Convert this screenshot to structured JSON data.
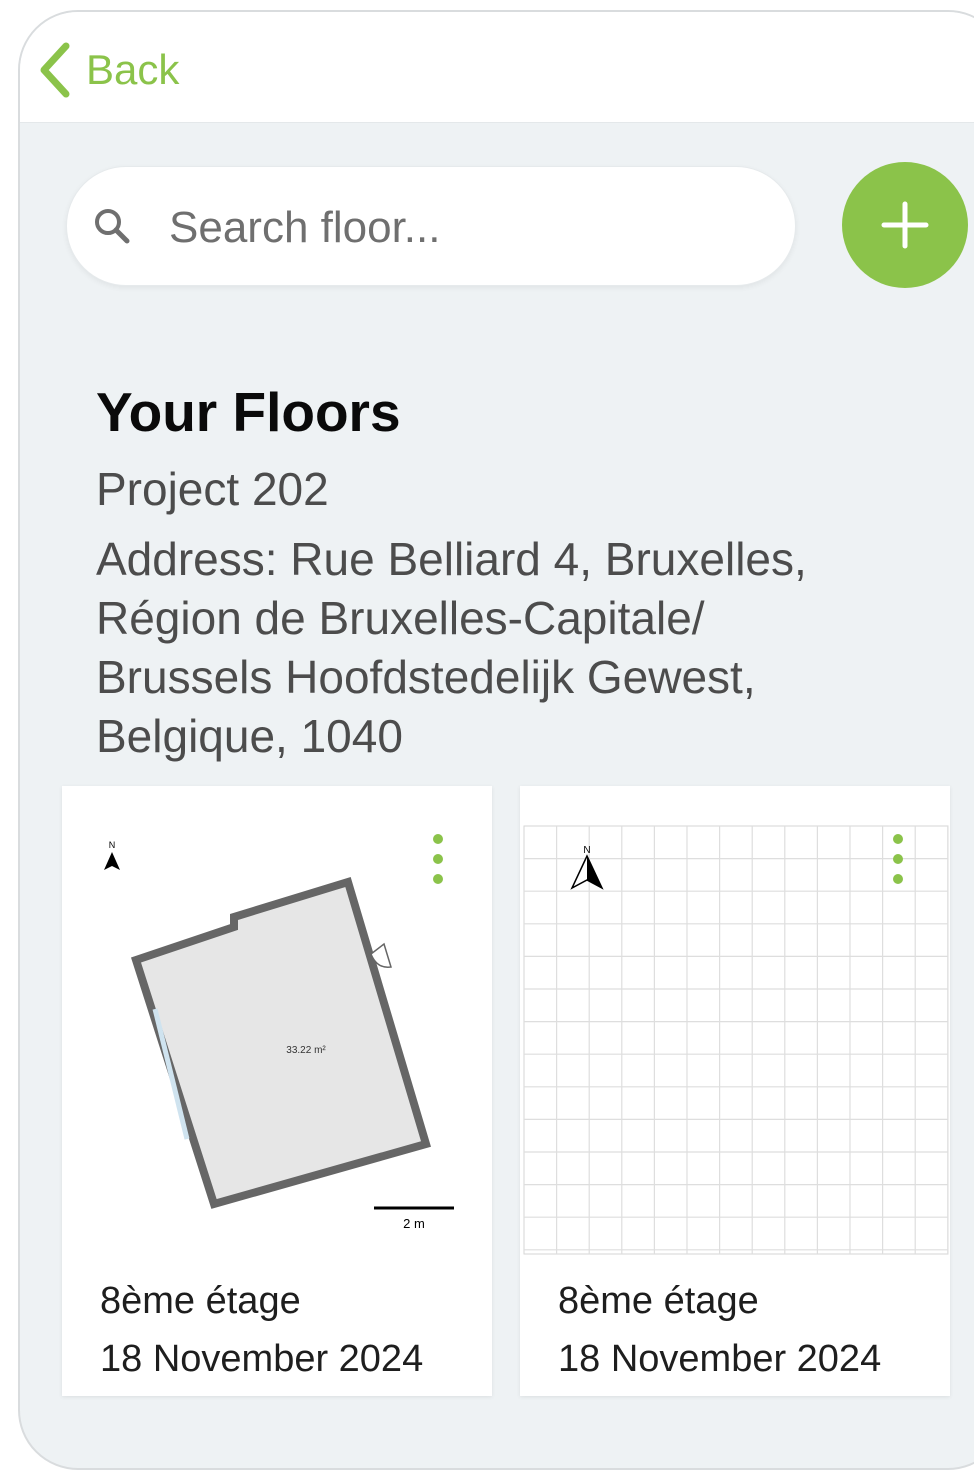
{
  "nav": {
    "back_label": "Back"
  },
  "search": {
    "placeholder": "Search floor...",
    "value": ""
  },
  "add_button": {
    "icon": "plus-icon"
  },
  "section": {
    "title": "Your Floors",
    "project_name": "Project 202",
    "address": "Address: Rue Belliard 4, Bruxelles, Région de Bruxelles-Capitale/ Brussels Hoofdstedelijk Gewest, Belgique, 1040"
  },
  "floors": [
    {
      "name": "8ème étage",
      "date": "18 November 2024",
      "plan_area": "33.22 m²",
      "scale_label": "2 m",
      "north_label": "N"
    },
    {
      "name": "8ème étage",
      "date": "18 November 2024",
      "north_label": "N"
    }
  ],
  "colors": {
    "accent": "#8bc34a",
    "background": "#eef2f4",
    "text_primary": "#0a0a0a",
    "text_secondary": "#4c4c4c"
  }
}
